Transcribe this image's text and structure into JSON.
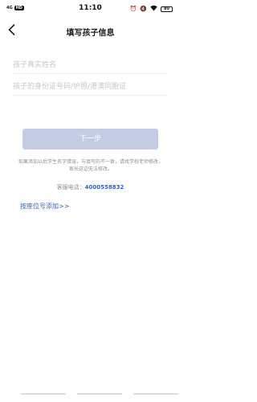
{
  "status_bar": {
    "signal": "4G",
    "hd": "HD",
    "time": "11:10",
    "battery": "80"
  },
  "nav": {
    "title": "填写孩子信息"
  },
  "form": {
    "name_placeholder": "孩子真实姓名",
    "id_placeholder": "孩子的身份证号码/护照/港澳同胞证",
    "next_label": "下一步"
  },
  "notice": {
    "text": "如果添加以后学生名字错误，与填写的不一致，请找学校老师修改，家长这边无法修改。"
  },
  "hotline": {
    "label": "客服电话：",
    "number": "4000558832"
  },
  "seat_link": {
    "label": "按座位号添加>>"
  }
}
